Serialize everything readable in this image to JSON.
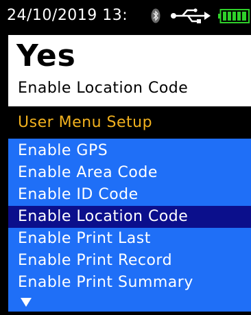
{
  "status_bar": {
    "datetime": "24/10/2019 13:",
    "icons": [
      "bluetooth-icon",
      "usb-icon",
      "battery-icon"
    ],
    "battery_color": "#2fd12a"
  },
  "value_panel": {
    "value": "Yes",
    "caption": "Enable Location Code"
  },
  "menu": {
    "header": "User Menu Setup",
    "header_color": "#f2b11e",
    "list_color": "#1f6ff7",
    "selected_color": "#0b0f8c",
    "items": [
      {
        "label": "Enable GPS",
        "selected": false
      },
      {
        "label": "Enable Area Code",
        "selected": false
      },
      {
        "label": "Enable ID Code",
        "selected": false
      },
      {
        "label": "Enable Location Code",
        "selected": true
      },
      {
        "label": "Enable Print Last",
        "selected": false
      },
      {
        "label": "Enable Print Record",
        "selected": false
      },
      {
        "label": "Enable Print Summary",
        "selected": false
      }
    ],
    "more_indicator": "scroll-down-arrow-icon"
  }
}
